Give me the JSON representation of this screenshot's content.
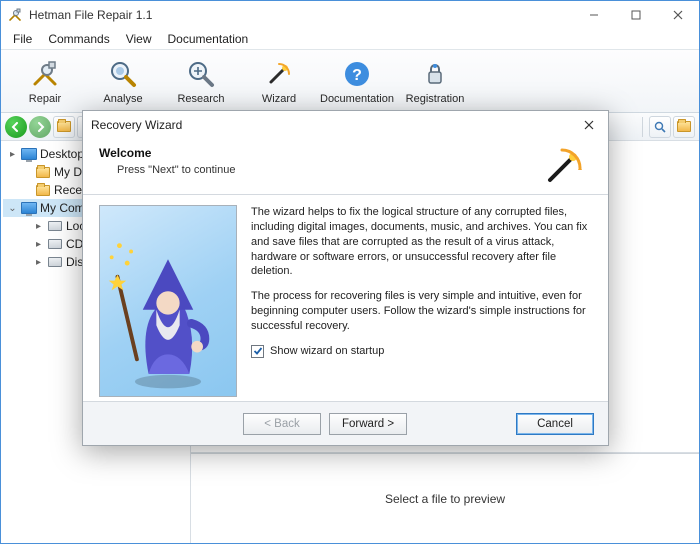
{
  "window": {
    "title": "Hetman File Repair 1.1"
  },
  "menu": {
    "items": [
      "File",
      "Commands",
      "View",
      "Documentation"
    ]
  },
  "toolbar": {
    "items": [
      {
        "label": "Repair",
        "icon": "repair-icon"
      },
      {
        "label": "Analyse",
        "icon": "analyse-icon"
      },
      {
        "label": "Research",
        "icon": "research-icon"
      },
      {
        "label": "Wizard",
        "icon": "wizard-icon"
      },
      {
        "label": "Documentation",
        "icon": "documentation-icon"
      },
      {
        "label": "Registration",
        "icon": "registration-icon"
      }
    ]
  },
  "tree": {
    "items": [
      {
        "label": "Desktop",
        "icon": "monitor",
        "depth": 0,
        "twisty": "▾",
        "selected": false
      },
      {
        "label": "My Documents",
        "icon": "folder",
        "depth": 1,
        "twisty": "",
        "selected": false
      },
      {
        "label": "Recent Documents",
        "icon": "folder",
        "depth": 1,
        "twisty": "",
        "selected": false
      },
      {
        "label": "My Computer",
        "icon": "monitor",
        "depth": 1,
        "twisty": "▾",
        "selected": true
      },
      {
        "label": "Local Disk",
        "icon": "drive",
        "depth": 2,
        "twisty": "▸",
        "selected": false
      },
      {
        "label": "CD Drive",
        "icon": "drive",
        "depth": 2,
        "twisty": "▸",
        "selected": false
      },
      {
        "label": "Disk (E:)",
        "icon": "drive",
        "depth": 2,
        "twisty": "▸",
        "selected": false
      }
    ]
  },
  "preview": {
    "empty_text": "Select a file to preview"
  },
  "dialog": {
    "title": "Recovery Wizard",
    "heading": "Welcome",
    "subheading": "Press \"Next\" to continue",
    "para1": "The wizard helps to fix the logical structure of any corrupted files, including digital images, documents, music, and archives. You can fix and save files that are corrupted as the result of a virus attack, hardware or software errors, or unsuccessful recovery after file deletion.",
    "para2": "The process for recovering files is very simple and intuitive, even for beginning computer users. Follow the wizard's simple instructions for successful recovery.",
    "checkbox_label": "Show wizard on startup",
    "checkbox_checked": true,
    "buttons": {
      "back": "< Back",
      "forward": "Forward >",
      "cancel": "Cancel"
    }
  }
}
